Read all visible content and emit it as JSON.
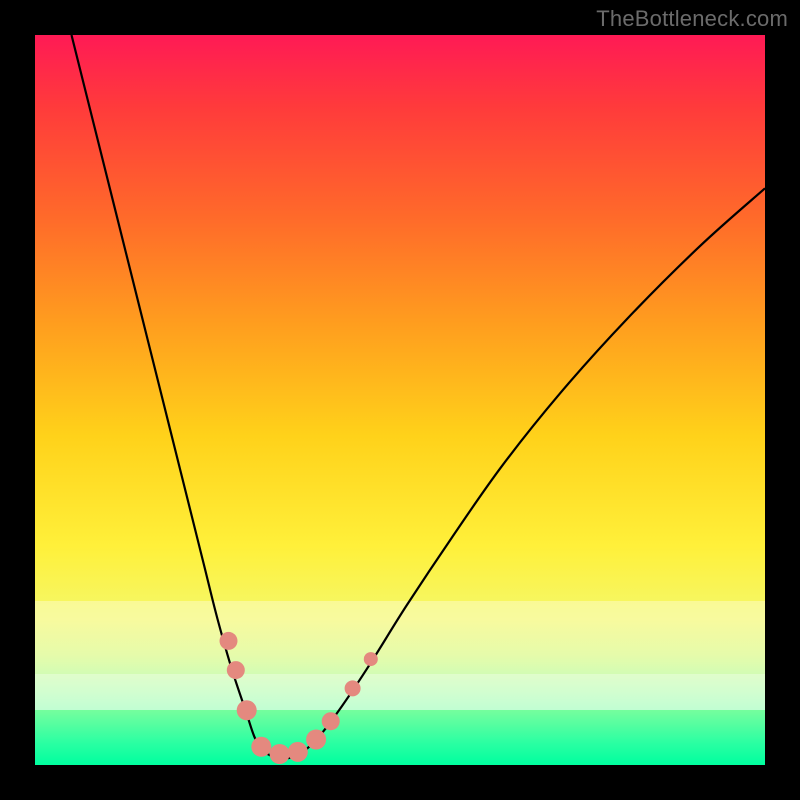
{
  "watermark": "TheBottleneck.com",
  "chart_data": {
    "type": "line",
    "title": "",
    "xlabel": "",
    "ylabel": "",
    "xlim": [
      0,
      100
    ],
    "ylim": [
      0,
      100
    ],
    "grid": false,
    "legend": false,
    "background_gradient": {
      "direction": "vertical",
      "stops": [
        {
          "pos": 0,
          "color": "#ff1a55"
        },
        {
          "pos": 25,
          "color": "#ff6a2a"
        },
        {
          "pos": 55,
          "color": "#ffd21a"
        },
        {
          "pos": 80,
          "color": "#f4f86a"
        },
        {
          "pos": 100,
          "color": "#00ff9f"
        }
      ]
    },
    "series": [
      {
        "name": "left-curve",
        "color": "#000000",
        "x": [
          5,
          8,
          11,
          14,
          17,
          20,
          23,
          25,
          27,
          29,
          30,
          31
        ],
        "y": [
          100,
          88,
          76,
          64,
          52,
          40,
          28,
          20,
          13,
          7,
          4,
          2
        ]
      },
      {
        "name": "right-curve",
        "color": "#000000",
        "x": [
          37,
          39,
          42,
          46,
          51,
          57,
          64,
          72,
          81,
          91,
          100
        ],
        "y": [
          2,
          4,
          8,
          14,
          22,
          31,
          41,
          51,
          61,
          71,
          79
        ]
      },
      {
        "name": "valley-floor",
        "color": "#000000",
        "x": [
          31,
          33,
          35,
          37
        ],
        "y": [
          2,
          1,
          1,
          2
        ]
      }
    ],
    "markers": [
      {
        "name": "left-dot-1",
        "x": 26.5,
        "y": 17,
        "color": "#e4897f",
        "r": 9
      },
      {
        "name": "left-dot-2",
        "x": 27.5,
        "y": 13,
        "color": "#e4897f",
        "r": 9
      },
      {
        "name": "left-dot-3",
        "x": 29.0,
        "y": 7.5,
        "color": "#e4897f",
        "r": 10
      },
      {
        "name": "floor-dot-1",
        "x": 31.0,
        "y": 2.5,
        "color": "#e4897f",
        "r": 10
      },
      {
        "name": "floor-dot-2",
        "x": 33.5,
        "y": 1.5,
        "color": "#e4897f",
        "r": 10
      },
      {
        "name": "floor-dot-3",
        "x": 36.0,
        "y": 1.8,
        "color": "#e4897f",
        "r": 10
      },
      {
        "name": "right-dot-1",
        "x": 38.5,
        "y": 3.5,
        "color": "#e4897f",
        "r": 10
      },
      {
        "name": "right-dot-2",
        "x": 40.5,
        "y": 6.0,
        "color": "#e4897f",
        "r": 9
      },
      {
        "name": "right-dot-3",
        "x": 43.5,
        "y": 10.5,
        "color": "#e4897f",
        "r": 8
      },
      {
        "name": "right-dot-4",
        "x": 46.0,
        "y": 14.5,
        "color": "#e4897f",
        "r": 7
      }
    ]
  }
}
